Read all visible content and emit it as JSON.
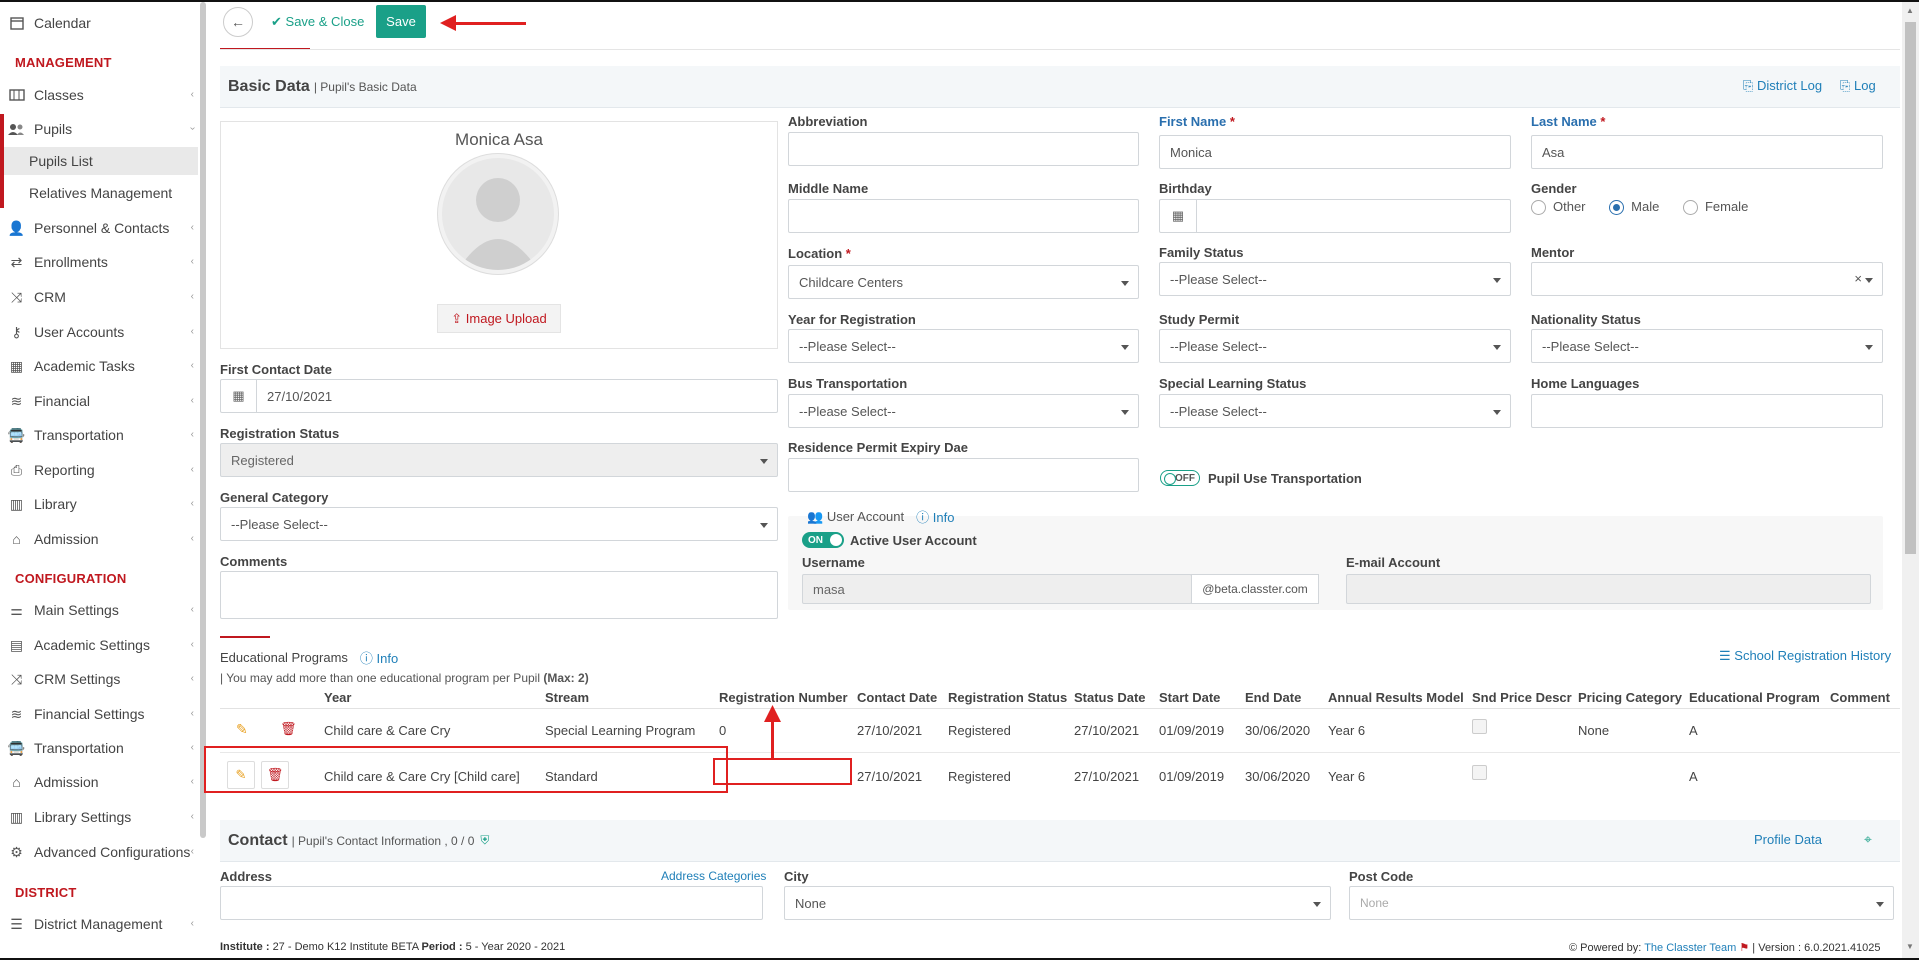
{
  "sidebar": {
    "top_item": {
      "label": "Calendar",
      "icon": "calendar-icon"
    },
    "section_management": "MANAGEMENT",
    "management_items": [
      {
        "label": "Classes",
        "icon": "classes-icon"
      },
      {
        "label": "Pupils",
        "icon": "pupils-icon"
      }
    ],
    "pupils_sub": [
      "Pupils List",
      "Relatives Management"
    ],
    "management_items_2": [
      {
        "label": "Personnel & Contacts",
        "icon": "personnel-icon"
      },
      {
        "label": "Enrollments",
        "icon": "exchange-icon"
      },
      {
        "label": "CRM",
        "icon": "crm-icon"
      },
      {
        "label": "User Accounts",
        "icon": "key-icon"
      },
      {
        "label": "Academic Tasks",
        "icon": "grid-icon"
      },
      {
        "label": "Financial",
        "icon": "coins-icon"
      },
      {
        "label": "Transportation",
        "icon": "bus-icon"
      },
      {
        "label": "Reporting",
        "icon": "printer-icon"
      },
      {
        "label": "Library",
        "icon": "books-icon"
      },
      {
        "label": "Admission",
        "icon": "institution-icon"
      }
    ],
    "section_configuration": "CONFIGURATION",
    "configuration_items": [
      {
        "label": "Main Settings",
        "icon": "sliders-icon"
      },
      {
        "label": "Academic Settings",
        "icon": "classes-icon"
      },
      {
        "label": "CRM Settings",
        "icon": "crm-icon"
      },
      {
        "label": "Financial Settings",
        "icon": "coins-icon"
      },
      {
        "label": "Transportation",
        "icon": "bus-icon"
      },
      {
        "label": "Admission",
        "icon": "institution-icon"
      },
      {
        "label": "Library Settings",
        "icon": "books-icon"
      },
      {
        "label": "Advanced Configurations",
        "icon": "cogs-icon"
      }
    ],
    "section_district": "DISTRICT",
    "district_items": [
      {
        "label": "District Management",
        "icon": "menu-icon"
      }
    ]
  },
  "toolbar": {
    "save_close_label": "Save & Close",
    "save_label": "Save"
  },
  "basic_data": {
    "title": "Basic Data",
    "subtitle": "| Pupil's Basic Data",
    "district_log": "District Log",
    "log": "Log",
    "pupil_name": "Monica Asa",
    "image_upload": "Image Upload",
    "first_contact_date_label": "First Contact Date",
    "first_contact_date": "27/10/2021",
    "registration_status_label": "Registration Status",
    "registration_status": "Registered",
    "general_category_label": "General Category",
    "general_category": "--Please Select--",
    "comments_label": "Comments",
    "abbreviation_label": "Abbreviation",
    "first_name_label": "First Name",
    "first_name": "Monica",
    "last_name_label": "Last Name",
    "last_name": "Asa",
    "middle_name_label": "Middle Name",
    "birthday_label": "Birthday",
    "gender_label": "Gender",
    "gender_options": [
      "Other",
      "Male",
      "Female"
    ],
    "gender_selected": "Male",
    "location_label": "Location",
    "location": "Childcare Centers",
    "family_status_label": "Family Status",
    "family_status": "--Please Select--",
    "mentor_label": "Mentor",
    "mentor_clear": "×",
    "year_reg_label": "Year for Registration",
    "year_reg": "--Please Select--",
    "study_permit_label": "Study Permit",
    "study_permit": "--Please Select--",
    "nationality_label": "Nationality Status",
    "nationality": "--Please Select--",
    "bus_label": "Bus Transportation",
    "bus": "--Please Select--",
    "special_label": "Special Learning Status",
    "special": "--Please Select--",
    "home_lang_label": "Home Languages",
    "residence_label": "Residence Permit Expiry Dae",
    "transport_toggle": "OFF",
    "transport_label": "Pupil Use Transportation",
    "user_account_label": "User Account",
    "info": "Info",
    "active_toggle": "ON",
    "active_label": "Active User Account",
    "username_label": "Username",
    "username": "masa",
    "domain": "@beta.classter.com",
    "email_label": "E-mail Account"
  },
  "programs": {
    "title": "Educational Programs",
    "info": "Info",
    "history": "School Registration History",
    "note_prefix": "| You may add more than one educational program per Pupil",
    "note_max": "(Max: 2)",
    "headers": [
      "Year",
      "Stream",
      "Registration Number",
      "Contact Date",
      "Registration Status",
      "Status Date",
      "Start Date",
      "End Date",
      "Annual Results Model",
      "Snd Price Descr",
      "Pricing Category",
      "Educational Program",
      "Comment"
    ],
    "rows": [
      {
        "year": "Child care & Care Cry",
        "stream": "Special Learning Program",
        "reg_no": "0",
        "contact": "27/10/2021",
        "status": "Registered",
        "status_date": "27/10/2021",
        "start": "01/09/2019",
        "end": "30/06/2020",
        "model": "Year 6",
        "pricing": "None",
        "program": "A"
      },
      {
        "year": "Child care & Care Cry [Child care]",
        "stream": "Standard",
        "reg_no": "",
        "contact": "27/10/2021",
        "status": "Registered",
        "status_date": "27/10/2021",
        "start": "01/09/2019",
        "end": "30/06/2020",
        "model": "Year 6",
        "pricing": "",
        "program": "A"
      }
    ]
  },
  "contact": {
    "title": "Contact",
    "subtitle": "| Pupil's Contact Information , 0 / 0",
    "profile_data": "Profile Data",
    "address_label": "Address",
    "address_categories": "Address Categories",
    "city_label": "City",
    "city": "None",
    "postcode_label": "Post Code",
    "postcode": "None"
  },
  "footer": {
    "institute_label": "Institute :",
    "institute": "27 - Demo K12 Institute BETA",
    "period_label": "Period :",
    "period": "5 - Year 2020 - 2021",
    "powered_by": "Powered by:",
    "team": "The Classter Team",
    "version": "| Version : 6.0.2021.41025"
  },
  "colors": {
    "brand_red": "#c0181f",
    "teal": "#1aa088",
    "link_blue": "#1f7fb8",
    "annotation_red": "#e02020"
  }
}
